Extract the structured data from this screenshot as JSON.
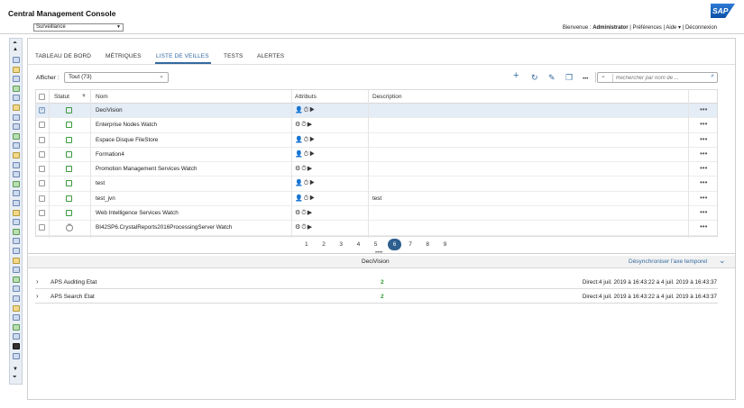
{
  "app": {
    "title": "Central Management Console",
    "logo": "SAP",
    "mode": "Surveillance"
  },
  "header": {
    "welcome": "Bienvenue : ",
    "user": "Administrator",
    "preferences": "Préférences",
    "help": "Aide ▾",
    "logout": "Déconnexion"
  },
  "tabs": [
    {
      "label": "TABLEAU DE BORD",
      "active": false
    },
    {
      "label": "MÉTRIQUES",
      "active": false
    },
    {
      "label": "LISTE DE VEILLES",
      "active": true
    },
    {
      "label": "TESTS",
      "active": false
    },
    {
      "label": "ALERTES",
      "active": false
    }
  ],
  "filter": {
    "label": "Afficher :",
    "value": "Tout (73)"
  },
  "toolbar": {
    "add": "+",
    "refresh": "↻",
    "edit": "✎",
    "copy": "❐",
    "more": "•••"
  },
  "search": {
    "placeholder": "Rechercher par nom de ..."
  },
  "columns": {
    "status": "Statut",
    "name": "Nom",
    "attributes": "Attributs",
    "description": "Description"
  },
  "rows": [
    {
      "name": "DeciVision",
      "attr": "👤⏱▶",
      "description": "",
      "status": "ok",
      "selected": true
    },
    {
      "name": "Enterprise Nodes Watch",
      "attr": "⚙⏱▶",
      "description": "",
      "status": "ok",
      "selected": false
    },
    {
      "name": "Espace Disque FileStore",
      "attr": "👤⏱▶",
      "description": "",
      "status": "ok",
      "selected": false
    },
    {
      "name": "Formation4",
      "attr": "👤⏱▶",
      "description": "",
      "status": "ok",
      "selected": false
    },
    {
      "name": "Promotion Management Services Watch",
      "attr": "⚙⏱▶",
      "description": "",
      "status": "ok",
      "selected": false
    },
    {
      "name": "test",
      "attr": "👤⏱▶",
      "description": "",
      "status": "ok",
      "selected": false
    },
    {
      "name": "test_jvn",
      "attr": "👤⏱▶",
      "description": "test",
      "status": "ok",
      "selected": false
    },
    {
      "name": "Web Intelligence Services Watch",
      "attr": "⚙⏱▶",
      "description": "",
      "status": "ok",
      "selected": false
    },
    {
      "name": "BI42SP6.CrystalReports2016ProcessingServer Watch",
      "attr": "⚙⏱▶",
      "description": "",
      "status": "off",
      "selected": false
    }
  ],
  "row_more": "•••",
  "pager": {
    "pages": [
      "1",
      "2",
      "3",
      "4",
      "5",
      "6",
      "7",
      "8",
      "9"
    ],
    "current": "6"
  },
  "detail": {
    "title": "DeciVision",
    "desync": "Désynchroniser l'axe temporel",
    "collapse": "⌄",
    "rows": [
      {
        "name": "APS Auditing Etat",
        "value": "2",
        "time": "Direct:4 juil. 2019 à 16:43:22 à 4 juil. 2019 à 16:43:37"
      },
      {
        "name": "APS Search Etat",
        "value": "2",
        "time": "Direct:4 juil. 2019 à 16:43:22 à 4 juil. 2019 à 16:43:37"
      }
    ]
  },
  "left_toolbar": {
    "up": "▲",
    "up_top": "⏶",
    "down": "▼",
    "down_bottom": "⏷"
  }
}
